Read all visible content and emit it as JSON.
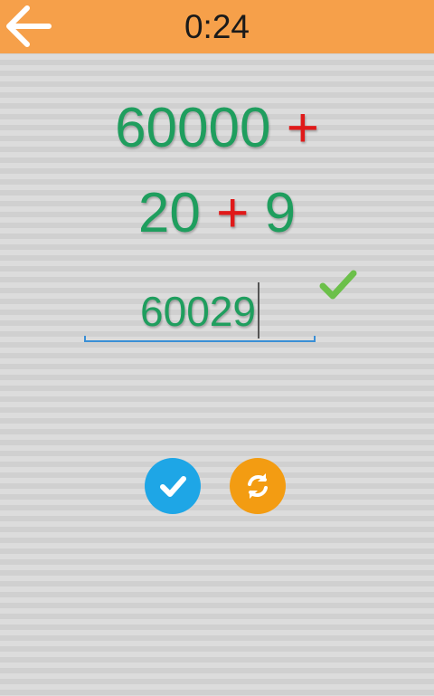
{
  "header": {
    "back_icon": "arrow-left-icon",
    "timer": "0:24"
  },
  "problem": {
    "term1": "60000",
    "op1": "+",
    "term2": "20",
    "op2": "+",
    "term3": "9"
  },
  "answer": {
    "value": "60029",
    "status": "correct",
    "status_icon": "checkmark-icon"
  },
  "actions": {
    "submit_icon": "check-icon",
    "reset_icon": "refresh-icon"
  },
  "colors": {
    "header_bg": "#f6a04a",
    "number_green": "#1f9e5e",
    "operator_red": "#e01a1a",
    "submit_blue": "#1ea6e6",
    "reset_orange": "#f39c12",
    "correct_green": "#6cc04a"
  }
}
